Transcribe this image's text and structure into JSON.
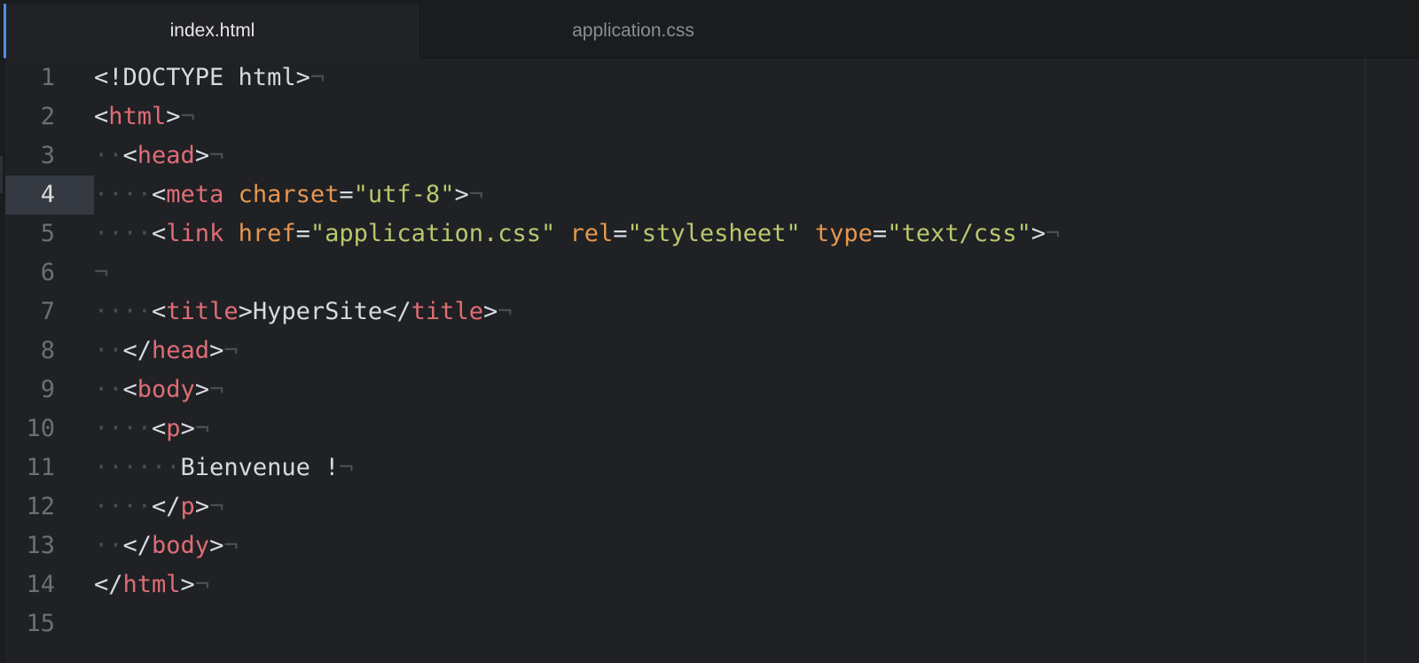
{
  "tabs": [
    {
      "label": "index.html",
      "active": true
    },
    {
      "label": "application.css",
      "active": false
    }
  ],
  "editor": {
    "cursor_line": 4,
    "line_numbers": [
      "1",
      "2",
      "3",
      "4",
      "5",
      "6",
      "7",
      "8",
      "9",
      "10",
      "11",
      "12",
      "13",
      "14",
      "15"
    ],
    "lines": [
      [
        {
          "t": "<!DOCTYPE html>",
          "c": "punct"
        },
        {
          "t": "¬",
          "c": "eol"
        }
      ],
      [
        {
          "t": "<",
          "c": "punct"
        },
        {
          "t": "html",
          "c": "tag"
        },
        {
          "t": ">",
          "c": "punct"
        },
        {
          "t": "¬",
          "c": "eol"
        }
      ],
      [
        {
          "t": "··",
          "c": "indent"
        },
        {
          "t": "<",
          "c": "punct"
        },
        {
          "t": "head",
          "c": "tag"
        },
        {
          "t": ">",
          "c": "punct"
        },
        {
          "t": "¬",
          "c": "eol"
        }
      ],
      [
        {
          "t": "····",
          "c": "indent"
        },
        {
          "t": "<",
          "c": "punct"
        },
        {
          "t": "meta",
          "c": "tag"
        },
        {
          "t": " ",
          "c": "punct"
        },
        {
          "t": "charset",
          "c": "attr"
        },
        {
          "t": "=",
          "c": "punct"
        },
        {
          "t": "\"utf-8\"",
          "c": "str"
        },
        {
          "t": ">",
          "c": "punct"
        },
        {
          "t": "¬",
          "c": "eol"
        }
      ],
      [
        {
          "t": "····",
          "c": "indent"
        },
        {
          "t": "<",
          "c": "punct"
        },
        {
          "t": "link",
          "c": "tag"
        },
        {
          "t": " ",
          "c": "punct"
        },
        {
          "t": "href",
          "c": "attr"
        },
        {
          "t": "=",
          "c": "punct"
        },
        {
          "t": "\"application.css\"",
          "c": "str"
        },
        {
          "t": " ",
          "c": "punct"
        },
        {
          "t": "rel",
          "c": "attr"
        },
        {
          "t": "=",
          "c": "punct"
        },
        {
          "t": "\"stylesheet\"",
          "c": "str"
        },
        {
          "t": " ",
          "c": "punct"
        },
        {
          "t": "type",
          "c": "attr"
        },
        {
          "t": "=",
          "c": "punct"
        },
        {
          "t": "\"text/css\"",
          "c": "str"
        },
        {
          "t": ">",
          "c": "punct"
        },
        {
          "t": "¬",
          "c": "eol"
        }
      ],
      [
        {
          "t": "¬",
          "c": "eol"
        }
      ],
      [
        {
          "t": "····",
          "c": "indent"
        },
        {
          "t": "<",
          "c": "punct"
        },
        {
          "t": "title",
          "c": "tag"
        },
        {
          "t": ">",
          "c": "punct"
        },
        {
          "t": "HyperSite",
          "c": "text"
        },
        {
          "t": "</",
          "c": "punct"
        },
        {
          "t": "title",
          "c": "tag"
        },
        {
          "t": ">",
          "c": "punct"
        },
        {
          "t": "¬",
          "c": "eol"
        }
      ],
      [
        {
          "t": "··",
          "c": "indent"
        },
        {
          "t": "</",
          "c": "punct"
        },
        {
          "t": "head",
          "c": "tag"
        },
        {
          "t": ">",
          "c": "punct"
        },
        {
          "t": "¬",
          "c": "eol"
        }
      ],
      [
        {
          "t": "··",
          "c": "indent"
        },
        {
          "t": "<",
          "c": "punct"
        },
        {
          "t": "body",
          "c": "tag"
        },
        {
          "t": ">",
          "c": "punct"
        },
        {
          "t": "¬",
          "c": "eol"
        }
      ],
      [
        {
          "t": "····",
          "c": "indent"
        },
        {
          "t": "<",
          "c": "punct"
        },
        {
          "t": "p",
          "c": "tag"
        },
        {
          "t": ">",
          "c": "punct"
        },
        {
          "t": "¬",
          "c": "eol"
        }
      ],
      [
        {
          "t": "······",
          "c": "indent"
        },
        {
          "t": "Bienvenue !",
          "c": "text"
        },
        {
          "t": "¬",
          "c": "eol"
        }
      ],
      [
        {
          "t": "····",
          "c": "indent"
        },
        {
          "t": "</",
          "c": "punct"
        },
        {
          "t": "p",
          "c": "tag"
        },
        {
          "t": ">",
          "c": "punct"
        },
        {
          "t": "¬",
          "c": "eol"
        }
      ],
      [
        {
          "t": "··",
          "c": "indent"
        },
        {
          "t": "</",
          "c": "punct"
        },
        {
          "t": "body",
          "c": "tag"
        },
        {
          "t": ">",
          "c": "punct"
        },
        {
          "t": "¬",
          "c": "eol"
        }
      ],
      [
        {
          "t": "</",
          "c": "punct"
        },
        {
          "t": "html",
          "c": "tag"
        },
        {
          "t": ">",
          "c": "punct"
        },
        {
          "t": "¬",
          "c": "eol"
        }
      ],
      []
    ]
  }
}
